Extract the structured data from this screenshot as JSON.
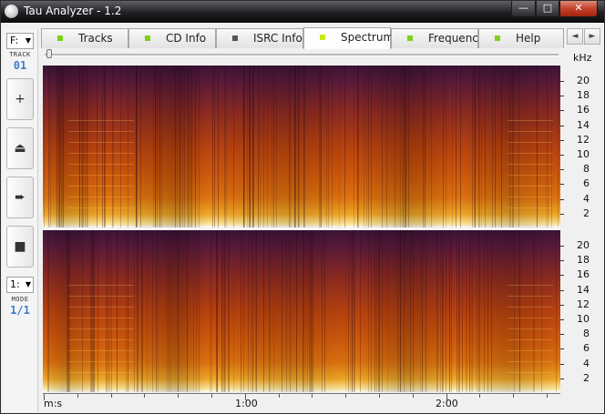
{
  "window": {
    "title": "Tau Analyzer - 1.2",
    "controls": {
      "minimize": "—",
      "maximize": "□",
      "close": "✕"
    }
  },
  "left_panel": {
    "drive_select": "F:",
    "track_label": "TRACK",
    "track_number": "01",
    "buttons": [
      {
        "icon": "plus-icon",
        "glyph": "+"
      },
      {
        "icon": "eject-icon",
        "glyph": "⏏"
      },
      {
        "icon": "play-icon",
        "glyph": "➨"
      },
      {
        "icon": "stop-icon",
        "glyph": "■"
      }
    ],
    "mode_select": "1:",
    "mode_label": "MODE",
    "mode_value": "1/1"
  },
  "tabs": [
    {
      "label": "Tracks",
      "led_color": "#7fd119",
      "active": false
    },
    {
      "label": "CD Info",
      "led_color": "#7fd119",
      "active": false
    },
    {
      "label": "ISRC Info",
      "led_color": "#555555",
      "active": false
    },
    {
      "label": "Spectrum",
      "led_color": "#c8e81a",
      "active": true
    },
    {
      "label": "Frequency",
      "led_color": "#7fd119",
      "active": false
    },
    {
      "label": "Help",
      "led_color": "#7fd119",
      "active": false
    }
  ],
  "tab_scroll": {
    "left": "◄",
    "right": "►"
  },
  "spectrum": {
    "unit_label": "kHz",
    "channels": 2,
    "freq_ticks": [
      "20",
      "18",
      "16",
      "14",
      "12",
      "10",
      "8",
      "6",
      "4",
      "2"
    ],
    "colors": {
      "low": "#3d1437",
      "mid": "#c04a0e",
      "high": "#fde79b"
    }
  },
  "time_axis": {
    "unit_label": "m:s",
    "labels": [
      "1:00",
      "2:00"
    ]
  }
}
